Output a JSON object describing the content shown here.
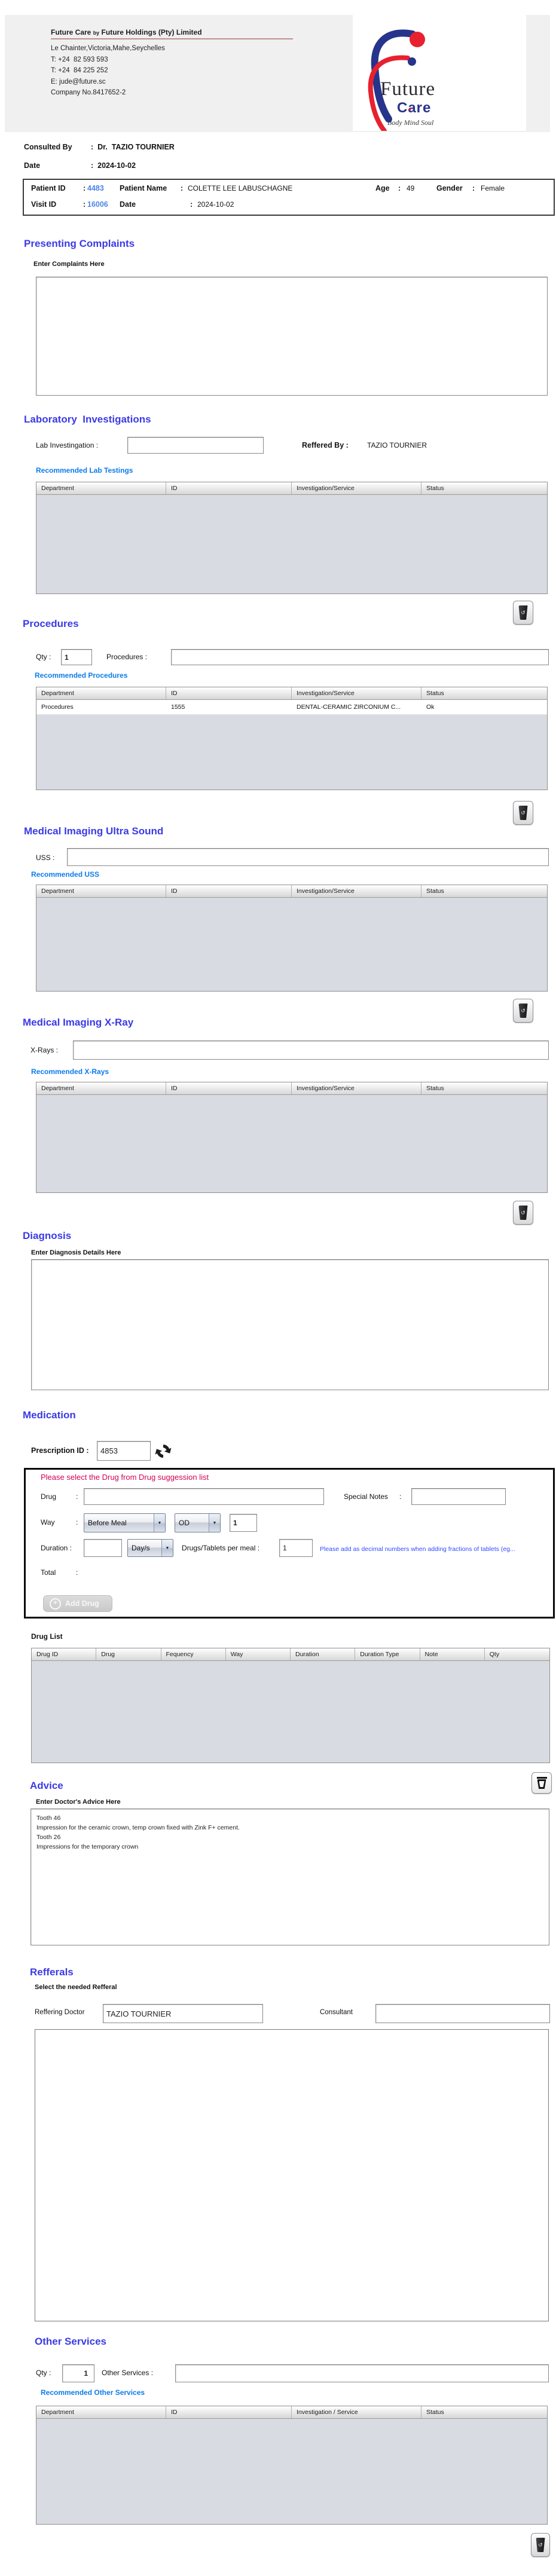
{
  "punct": {
    "colon": ":"
  },
  "colors": {
    "title_blue": "#3a3ae6",
    "link_blue": "#0b7bea",
    "id_blue": "#4a86e8",
    "warn_red": "#d40055",
    "note_blue": "#2f4cff"
  },
  "letterhead": {
    "company_prefix": "Future Care ",
    "company_by": "by",
    "company_suffix": " Future Holdings (Pty) Limited",
    "address": "Le Chainter,Victoria,Mahe,Seychelles",
    "phone1": "T: +24  82 593 593",
    "phone2": "T: +24  84 225 252",
    "email": "E: jude@future.sc",
    "company_no": "Company No.8417652-2",
    "logo_line1": "Future",
    "logo_line2": "Care",
    "logo_heart": "♥",
    "logo_tagline": "Body Mind Soul"
  },
  "consultation": {
    "consulted_by_label": "Consulted By",
    "consulted_by_value": "Dr.  TAZIO TOURNIER",
    "date_label": "Date",
    "date_value": "2024-10-02"
  },
  "patient": {
    "id_label": "Patient ID",
    "id_value": "4483",
    "name_label": "Patient Name",
    "name_value": "COLETTE LEE LABUSCHAGNE",
    "age_label": "Age",
    "age_value": "49",
    "gender_label": "Gender",
    "gender_value": "Female",
    "visit_label": "Visit ID",
    "visit_value": "16006",
    "date_label": "Date",
    "date_value": "2024-10-02"
  },
  "complaints": {
    "title": "Presenting Complaints",
    "label": "Enter Complaints Here",
    "value": ""
  },
  "lab": {
    "title": "Laboratory  Investigations",
    "input_label": "Lab Investingation :",
    "input_value": "",
    "referred_label": "Reffered By :",
    "referred_value": "TAZIO TOURNIER",
    "recommended": "Recommended Lab Testings",
    "columns": [
      "Department",
      "ID",
      "Investigation/Service",
      "Status"
    ]
  },
  "procedures": {
    "title": "Procedures",
    "qty_label": "Qty :",
    "qty_value": "1",
    "input_label": "Procedures :",
    "input_value": "",
    "recommended": "Recommended Procedures",
    "columns": [
      "Department",
      "ID",
      "Investigation/Service",
      "Status"
    ],
    "rows": [
      [
        "Procedures",
        "1555",
        "DENTAL-CERAMIC ZIRCONIUM C...",
        "Ok"
      ]
    ]
  },
  "uss": {
    "title": "Medical Imaging Ultra Sound",
    "input_label": "USS :",
    "input_value": "",
    "recommended": "Recommended USS",
    "columns": [
      "Department",
      "ID",
      "Investigation/Service",
      "Status"
    ]
  },
  "xray": {
    "title": "Medical Imaging X-Ray",
    "input_label": "X-Rays :",
    "input_value": "",
    "recommended": "Recommended X-Rays",
    "columns": [
      "Department",
      "ID",
      "Investigation/Service",
      "Status"
    ]
  },
  "diagnosis": {
    "title": "Diagnosis",
    "label": "Enter Diagnosis Details Here",
    "value": ""
  },
  "medication": {
    "title": "Medication",
    "prescription_label": "Prescription ID :",
    "prescription_id": "4853",
    "warning": "Please select the Drug from Drug suggession list",
    "drug_label": "Drug",
    "drug_value": "",
    "special_notes_label": "Special Notes",
    "special_notes_value": "",
    "way_label": "Way",
    "way_value": "Before Meal",
    "freq_value": "OD",
    "times_value": "1",
    "duration_label": "Duration :",
    "duration_value": "",
    "duration_unit": "Day/s",
    "per_meal_label": "Drugs/Tablets per meal :",
    "per_meal_value": "1",
    "note": "Please add as decimal numbers when adding fractions of tablets (eg...",
    "total_label": "Total",
    "add_drug_label": "Add Drug",
    "drug_list_label": "Drug List",
    "drug_columns": [
      "Drug ID",
      "Drug",
      "Fequency",
      "Way",
      "Duration",
      "Duration Type",
      "Note",
      "Qty"
    ]
  },
  "advice": {
    "title": "Advice",
    "label": "Enter Doctor's Advice Here",
    "value": "Tooth 46\nImpression for the ceramic crown, temp crown fixed with Zink F+ cement.\nTooth 26\nImpressions for the temporary crown"
  },
  "refferals": {
    "title": "Refferals",
    "label": "Select the needed Refferal",
    "doctor_label": "Reffering Doctor",
    "doctor_value": "TAZIO TOURNIER",
    "consultant_label": "Consultant",
    "consultant_value": ""
  },
  "other": {
    "title": "Other Services",
    "qty_label": "Qty :",
    "qty_value": "1",
    "input_label": "Other Services :",
    "input_value": "",
    "recommended": "Recommended Other Services",
    "columns": [
      "Department",
      "ID",
      "Investigation / Service",
      "Status"
    ]
  }
}
